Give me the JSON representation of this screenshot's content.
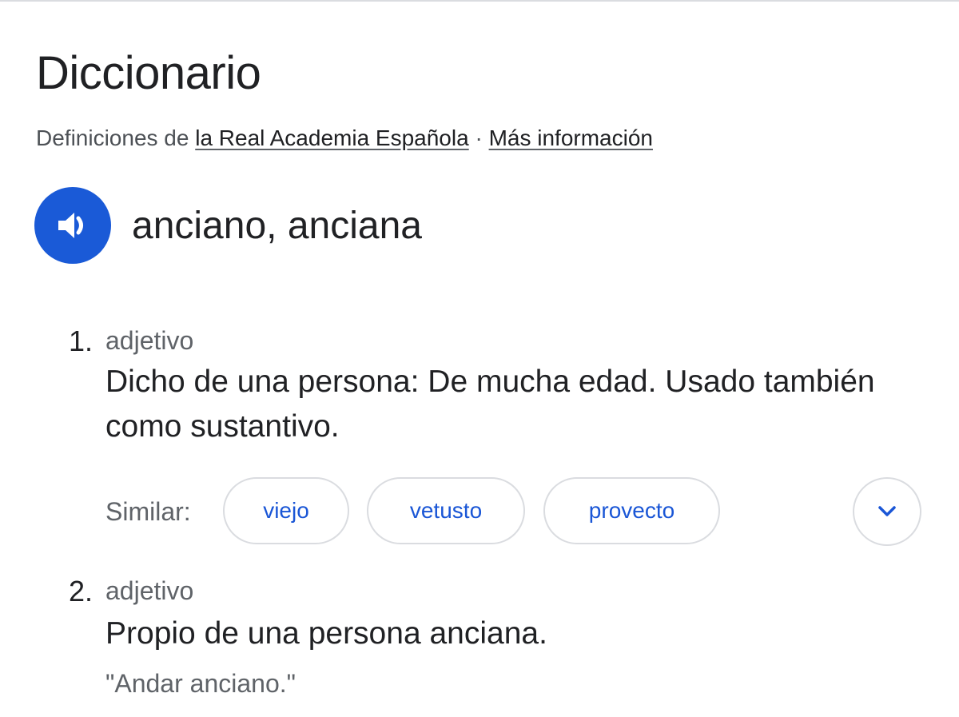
{
  "header": {
    "title": "Diccionario",
    "source_prefix": "Definiciones de ",
    "source_link": "la Real Academia Española",
    "separator": " · ",
    "more_info_link": "Más información"
  },
  "entry": {
    "headword": "anciano, anciana",
    "speaker_icon": "volume-icon",
    "accent_color": "#1a5ad7"
  },
  "senses": [
    {
      "number": "1.",
      "part_of_speech": "adjetivo",
      "definition": "Dicho de una persona: De mucha edad. Usado también como sustantivo.",
      "similar_label": "Similar:",
      "similar": [
        "viejo",
        "vetusto",
        "provecto"
      ],
      "expand_icon": "chevron-down-icon"
    },
    {
      "number": "2.",
      "part_of_speech": "adjetivo",
      "definition": "Propio de una persona anciana.",
      "example": "\"Andar anciano.\""
    }
  ]
}
